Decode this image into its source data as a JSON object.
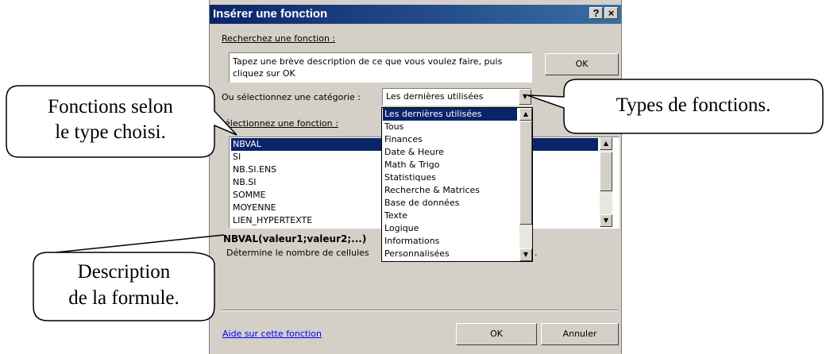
{
  "dialog": {
    "title": "Insérer une fonction",
    "help_button": "?",
    "close_button": "×",
    "search_label": "Recherchez une fonction :",
    "search_text": "Tapez une brève description de ce que vous voulez faire, puis cliquez sur OK",
    "ok_search": "OK",
    "category_label": "Ou sélectionnez une catégorie :",
    "category_value": "Les dernières utilisées",
    "function_label": "électionnez une fonction :",
    "functions": [
      "NBVAL",
      "SI",
      "NB.SI.ENS",
      "NB.SI",
      "SOMME",
      "MOYENNE",
      "LIEN_HYPERTEXTE"
    ],
    "selected_function": "NBVAL",
    "categories": [
      "Les dernières utilisées",
      "Tous",
      "Finances",
      "Date & Heure",
      "Math & Trigo",
      "Statistiques",
      "Recherche & Matrices",
      "Base de données",
      "Texte",
      "Logique",
      "Informations",
      "Personnalisées"
    ],
    "selected_category": "Les dernières utilisées",
    "syntax": "NBVAL(valeur1;valeur2;...)",
    "description": "Détermine le nombre de cellules",
    "description_tail": ".",
    "help_link": "Aide sur cette fonction",
    "ok_button": "OK",
    "cancel_button": "Annuler"
  },
  "callouts": {
    "functions_by_type_line1": "Fonctions selon",
    "functions_by_type_line2": "le type choisi.",
    "function_types": "Types de fonctions.",
    "formula_desc_line1": "Description",
    "formula_desc_line2": "de la formule."
  },
  "colors": {
    "dialog_bg": "#d4d0c8",
    "title_bar": "#0a246a",
    "selection": "#0a246a",
    "link": "#0000ff"
  },
  "icons": {
    "scroll_up": "triangle-up-icon",
    "scroll_down": "triangle-down-icon",
    "dropdown": "triangle-down-icon"
  }
}
